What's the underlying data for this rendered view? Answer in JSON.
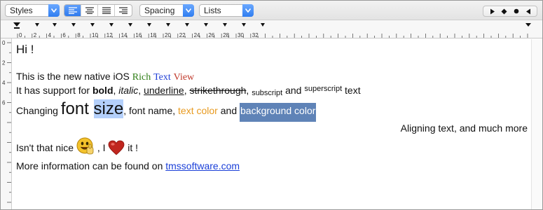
{
  "toolbar": {
    "styles_value": "Styles",
    "spacing_value": "Spacing",
    "lists_value": "Lists",
    "align_active": "left",
    "nav_icons": [
      "play-icon",
      "diamond-icon",
      "record-icon",
      "reverse-play-icon"
    ]
  },
  "ruler": {
    "labels": [
      "0",
      "2",
      "4",
      "6",
      "8",
      "10",
      "12",
      "14",
      "16",
      "18",
      "20",
      "22",
      "24",
      "26",
      "28",
      "30",
      "32"
    ],
    "vlabels": [
      "0",
      "2",
      "4",
      "6"
    ]
  },
  "content": {
    "hi": "Hi !",
    "line1": {
      "prefix": "This is the new native iOS ",
      "rich": "Rich",
      "text": "Text",
      "view": "View"
    },
    "line2": {
      "prefix": "It has support for ",
      "bold": "bold",
      "comma1": ", ",
      "italic": "italic",
      "comma2": ", ",
      "underline": "underline",
      "comma3": ", ",
      "strike": "strikethrough",
      "comma4": ", ",
      "subscript": "subscript",
      "and": " and ",
      "superscript": "superscript",
      "suffix": " text"
    },
    "line3": {
      "prefix": "Changing ",
      "font": "font",
      "space": " ",
      "size": "size",
      "mid": ", font name, ",
      "textcolor": "text color",
      "and": " and ",
      "bgcolor": "background color"
    },
    "line4": "Aligning text, and much more",
    "line5": {
      "prefix": "Isn't that nice ",
      "mid": " , I ",
      "suffix": " it !"
    },
    "line6": {
      "prefix": "More information can be found on ",
      "link": "tmssoftware.com"
    }
  },
  "colors": {
    "accent": "#2f7df0",
    "rich": "#2e7d15",
    "text": "#1f3fd6",
    "view": "#c0392b",
    "text_color_sample": "#e89a1f",
    "background_color_sample": "#5f83b7",
    "selection": "#b4d0fb",
    "link": "#1a3fd8"
  }
}
